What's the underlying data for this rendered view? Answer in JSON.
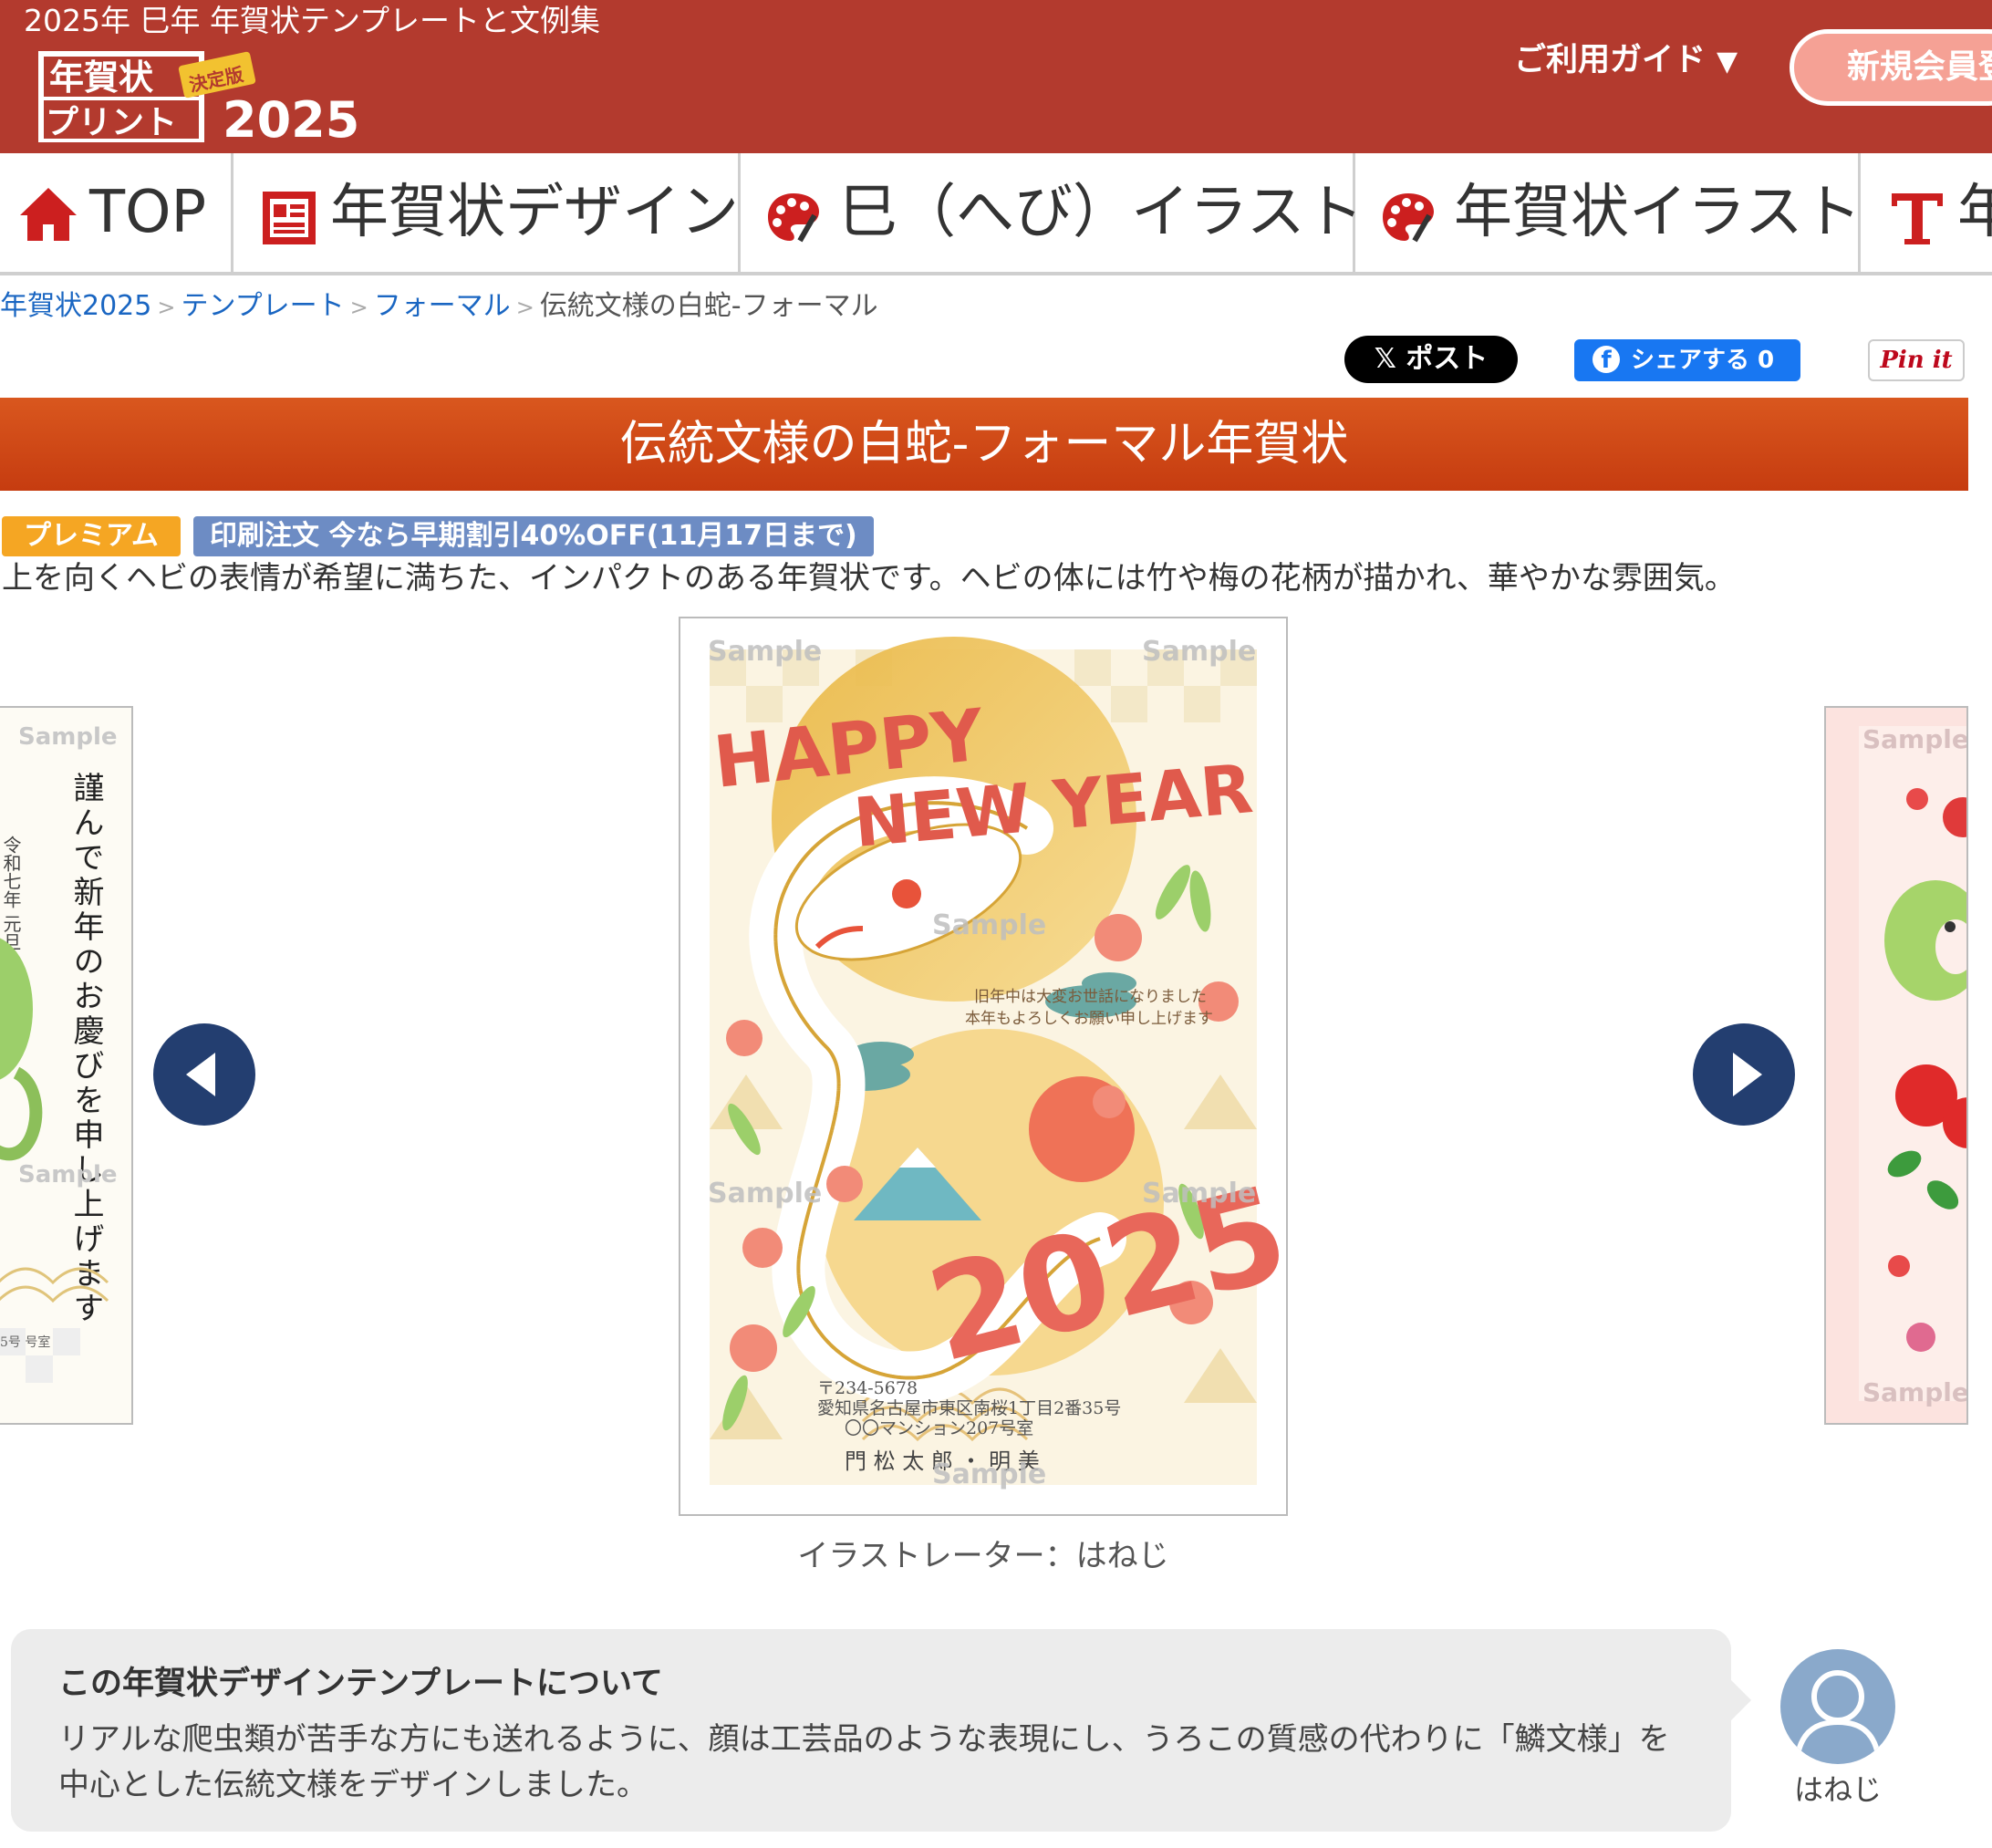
{
  "header": {
    "tagline": "2025年 巳年 年賀状テンプレートと文例集",
    "logo": {
      "line1": "年賀状",
      "line2": "プリント",
      "badge": "決定版",
      "year": "2025"
    },
    "guide_label": "ご利用ガイド",
    "guide_caret": "▼",
    "register_label": "新規会員登録"
  },
  "nav": {
    "items": [
      {
        "label": "TOP",
        "icon": "home-icon"
      },
      {
        "label": "年賀状デザイン",
        "icon": "design-icon"
      },
      {
        "label": "巳（へび）イラスト",
        "icon": "palette-icon"
      },
      {
        "label": "年賀状イラスト",
        "icon": "palette-icon"
      },
      {
        "label": "年賀状文例",
        "icon": "text-icon"
      }
    ]
  },
  "breadcrumb": {
    "items": [
      "年賀状2025",
      "テンプレート",
      "フォーマル"
    ],
    "separator": ">",
    "current": "伝統文様の白蛇-フォーマル"
  },
  "share": {
    "x_label": "ポスト",
    "fb_label": "シェアする 0",
    "pin_label": "Pin it"
  },
  "title": "伝統文様の白蛇-フォーマル年賀状",
  "tags": {
    "premium": "プレミアム",
    "sale": "印刷注文 今なら早期割引40%OFF(11月17日まで)"
  },
  "description": "上を向くヘビの表情が希望に満ちた、インパクトのある年賀状です。ヘビの体には竹や梅の花柄が描かれ、華やかな雰囲気。",
  "card": {
    "watermark": "Sample",
    "headline_line1": "HAPPY",
    "headline_line2": "NEW YEAR",
    "greeting_line1": "旧年中は大変お世話になりました",
    "greeting_line2": "本年もよろしくお願い申し上げます",
    "year_text": "2025",
    "postal": "〒234-5678",
    "address1": "愛知県名古屋市東区南桜1丁目2番35号",
    "address2": "〇〇マンション207号室",
    "names": "門 松 太 郎 ・ 明 美"
  },
  "left_card": {
    "watermark": "Sample",
    "main_text": "謹んで新年のお慶びを申し上げます",
    "date_text": "令和七年 元旦",
    "address_fragment": "5号 号室"
  },
  "right_card": {
    "watermark": "Sample"
  },
  "credit": "イラストレーター：はねじ",
  "about": {
    "title": "この年賀状デザインテンプレートについて",
    "text": "リアルな爬虫類が苦手な方にも送れるように、顔は工芸品のような表現にし、うろこの質感の代わりに「鱗文様」を中心とした伝統文様をデザインしました。"
  },
  "author": {
    "name": "はねじ"
  },
  "colors": {
    "header_bg": "#b33a2e",
    "title_bar": "#c9440f",
    "premium_tag": "#f5a623",
    "sale_tag": "#6d8cc4",
    "carousel_arrow": "#233e70",
    "link": "#1a66c2"
  }
}
